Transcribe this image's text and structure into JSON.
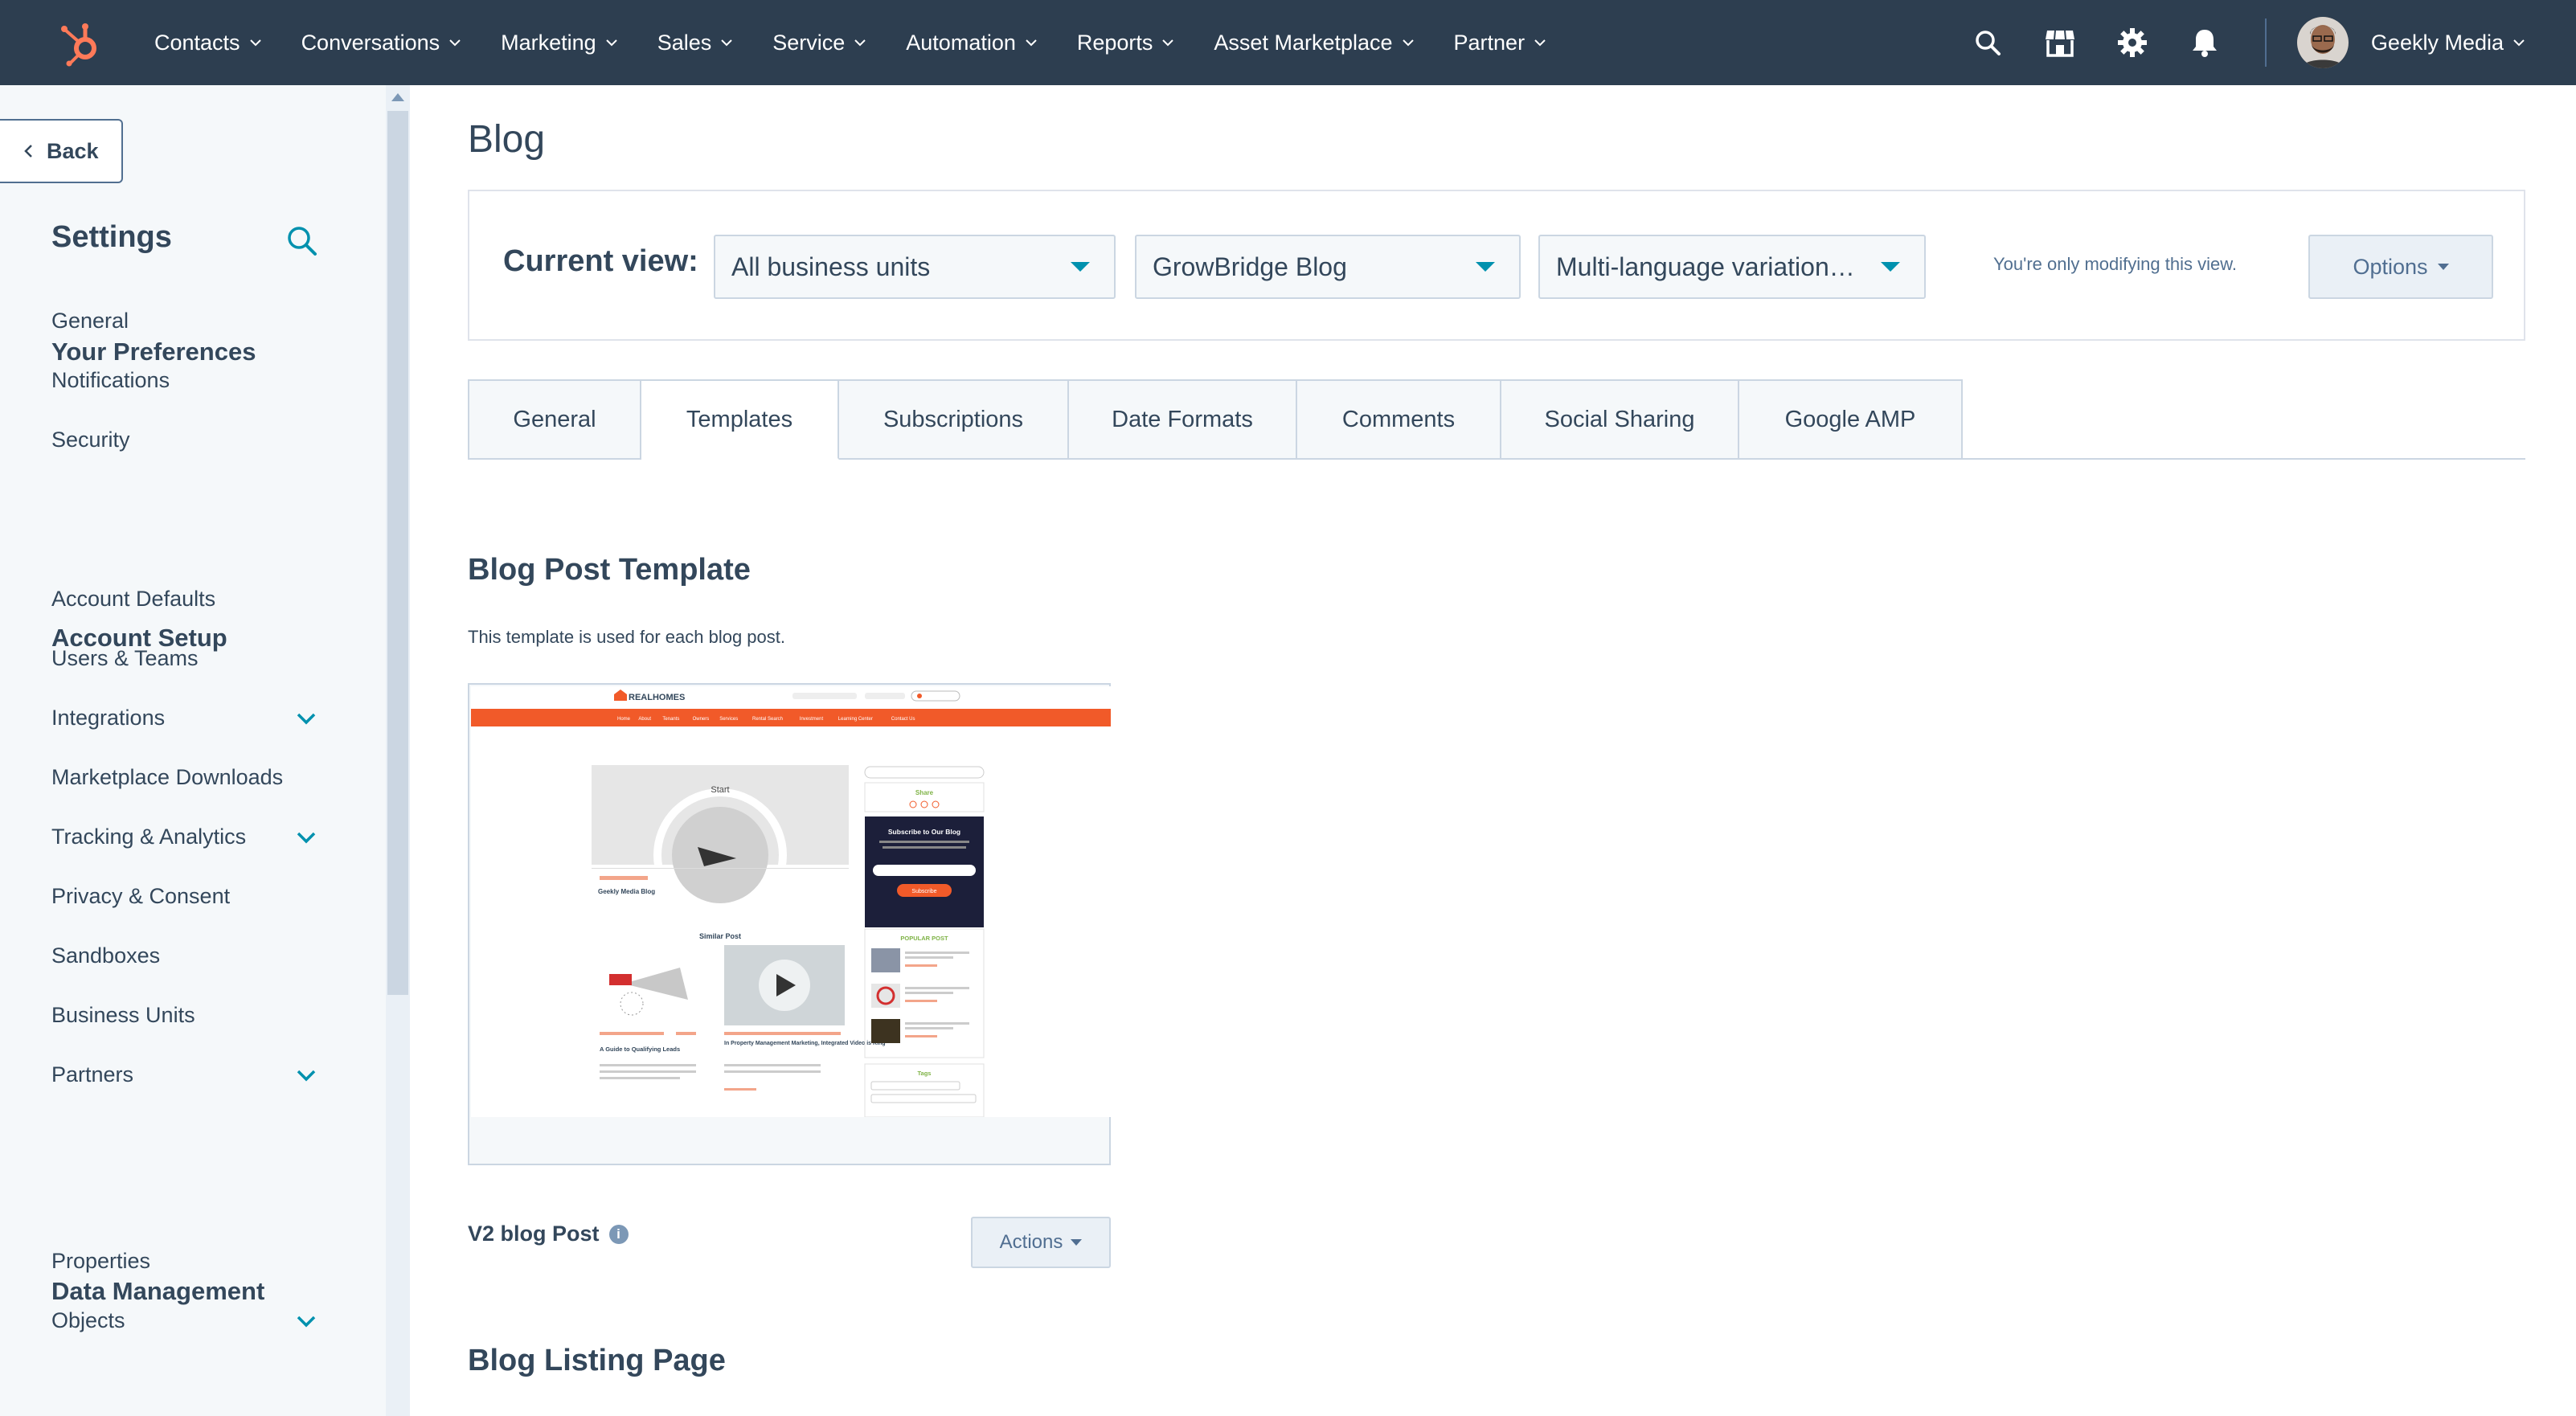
{
  "nav": {
    "items": [
      {
        "label": "Contacts"
      },
      {
        "label": "Conversations"
      },
      {
        "label": "Marketing"
      },
      {
        "label": "Sales"
      },
      {
        "label": "Service"
      },
      {
        "label": "Automation"
      },
      {
        "label": "Reports"
      },
      {
        "label": "Asset Marketplace"
      },
      {
        "label": "Partner"
      }
    ],
    "account_name": "Geekly Media",
    "colors": {
      "bar": "#2d3e50",
      "logo": "#ff7a59"
    }
  },
  "sidebar": {
    "back_label": "Back",
    "title": "Settings",
    "sections": [
      {
        "title": "Your Preferences"
      },
      {
        "title": "Account Setup"
      },
      {
        "title": "Data Management"
      }
    ],
    "items": [
      {
        "label": "General",
        "expandable": false
      },
      {
        "label": "Notifications",
        "expandable": false
      },
      {
        "label": "Security",
        "expandable": false
      },
      {
        "label": "Account Defaults",
        "expandable": false
      },
      {
        "label": "Users & Teams",
        "expandable": false
      },
      {
        "label": "Integrations",
        "expandable": true
      },
      {
        "label": "Marketplace Downloads",
        "expandable": false
      },
      {
        "label": "Tracking & Analytics",
        "expandable": true
      },
      {
        "label": "Privacy & Consent",
        "expandable": false
      },
      {
        "label": "Sandboxes",
        "expandable": false
      },
      {
        "label": "Business Units",
        "expandable": false
      },
      {
        "label": "Partners",
        "expandable": true
      },
      {
        "label": "Properties",
        "expandable": false
      },
      {
        "label": "Objects",
        "expandable": true
      }
    ]
  },
  "main": {
    "page_title": "Blog",
    "current_view_label": "Current view:",
    "selects": [
      {
        "value": "All business units"
      },
      {
        "value": "GrowBridge Blog"
      },
      {
        "value": "Multi-language variation…"
      }
    ],
    "modify_note": "You're only modifying this view.",
    "options_label": "Options",
    "tabs": [
      {
        "label": "General"
      },
      {
        "label": "Templates",
        "active": true
      },
      {
        "label": "Subscriptions"
      },
      {
        "label": "Date Formats"
      },
      {
        "label": "Comments"
      },
      {
        "label": "Social Sharing"
      },
      {
        "label": "Google AMP"
      }
    ],
    "blog_post_template": {
      "title": "Blog Post Template",
      "description": "This template is used for each blog post.",
      "template_name": "V2 blog Post",
      "info_glyph": "i",
      "actions_label": "Actions"
    },
    "blog_listing_title": "Blog Listing Page"
  },
  "thumbnail": {
    "brand": "REALHOMES",
    "brand_color": "#f15a29",
    "nav_links": [
      "Home",
      "About",
      "Tenants",
      "Owners",
      "Services",
      "Rental Search",
      "Investment",
      "Learning Center",
      "Contact Us"
    ],
    "player_label": "Start",
    "post_title": "Geekly Media Blog",
    "similar_label": "Similar Post",
    "card_titles": [
      "A Guide to Qualifying Leads",
      "In Property Management Marketing, Integrated Video is King"
    ],
    "sidebar_share": "Share",
    "subscribe_title": "Subscribe to Our Blog",
    "subscribe_btn": "Subscribe",
    "popular_label": "POPULAR POST",
    "tags_label": "Tags"
  }
}
